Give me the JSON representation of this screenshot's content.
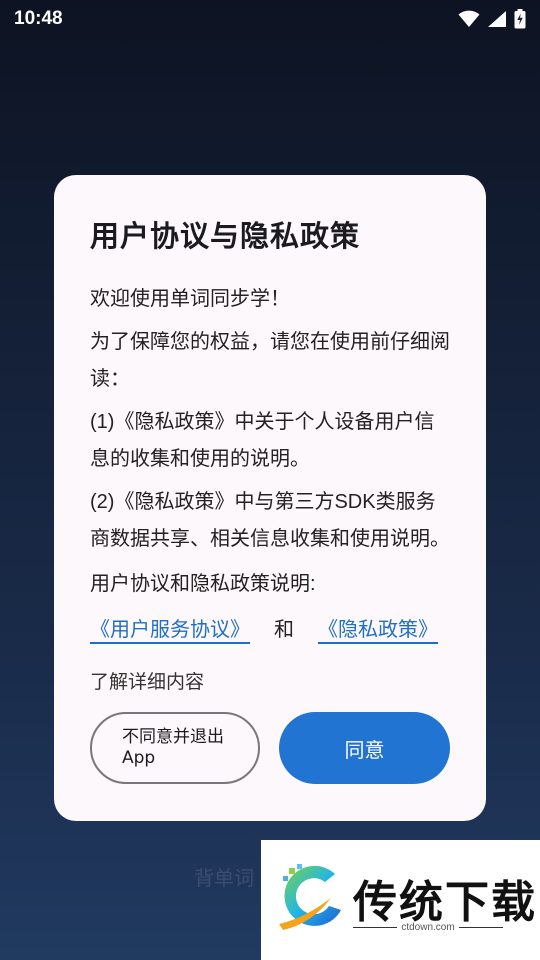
{
  "status_bar": {
    "time": "10:48",
    "icons": [
      "wifi-icon",
      "signal-icon",
      "battery-charging-icon"
    ]
  },
  "background": {
    "label": "背单词"
  },
  "dialog": {
    "title": "用户协议与隐私政策",
    "welcome": "欢迎使用单词同步学！",
    "intro": "为了保障您的权益，请您在使用前仔细阅读：",
    "item1": "(1)《隐私政策》中关于个人设备用户信息的收集和使用的说明。",
    "item2": "(2)《隐私政策》中与第三方SDK类服务商数据共享、相关信息收集和使用说明。",
    "links_intro": "用户协议和隐私政策说明:",
    "link_user_agreement": "《用户服务协议》",
    "link_conjunction": "和",
    "link_privacy": "《隐私政策》",
    "detail_link": "了解详细内容",
    "decline_button": "不同意并退出App",
    "agree_button": "同意"
  },
  "watermark": {
    "brand": "传统下载",
    "domain": "ctdown.com"
  },
  "colors": {
    "accent": "#2174d1",
    "link": "#1f6fc5",
    "dialog_bg": "#fdf8fb"
  }
}
